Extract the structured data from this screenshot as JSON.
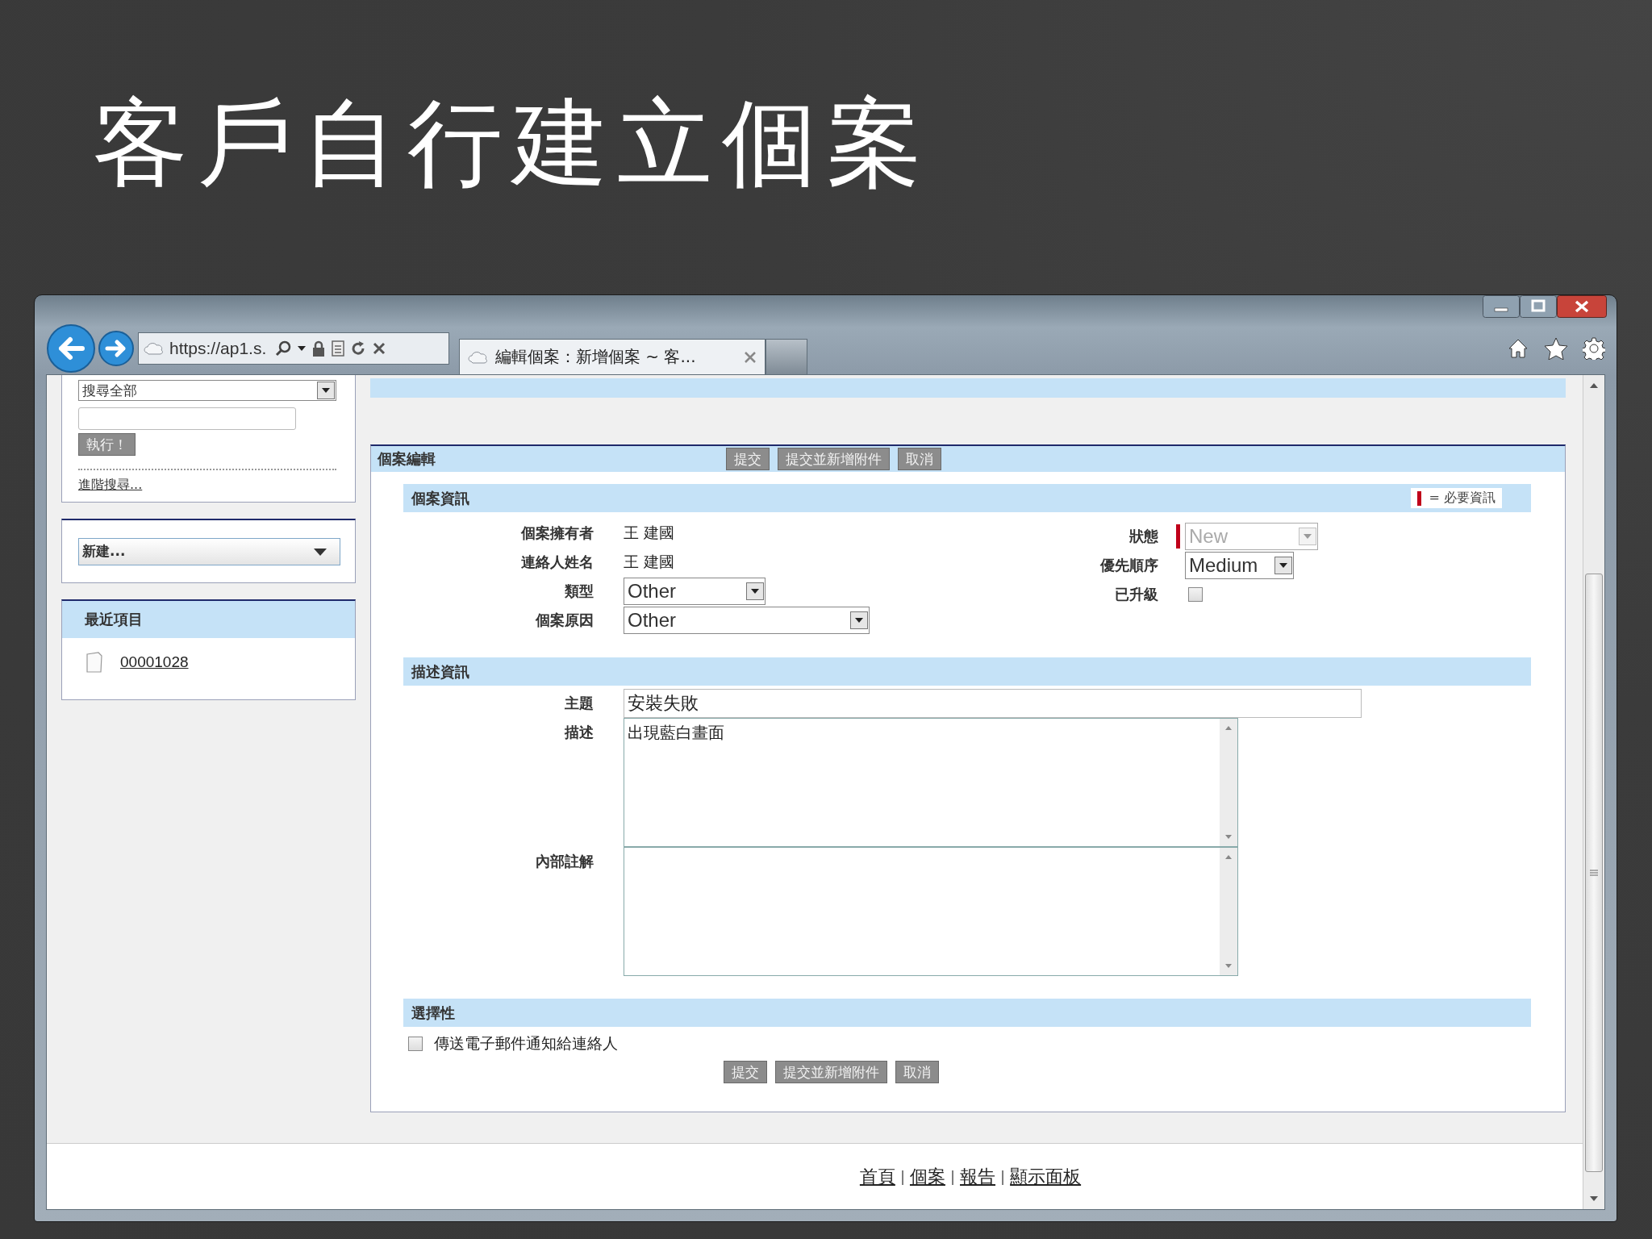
{
  "slide_title": "客戶自行建立個案",
  "browser": {
    "address": "https://ap1.s.",
    "tab_title": "編輯個案：新增個案 ~ 客..."
  },
  "sidebar": {
    "search_scope": "搜尋全部",
    "search_button": "執行！",
    "advanced_search": "進階搜尋...",
    "create_new": "新建...",
    "recent_title": "最近項目",
    "recent_items": [
      {
        "label": "00001028"
      }
    ]
  },
  "case_edit": {
    "title": "個案編輯",
    "top_buttons": [
      "提交",
      "提交並新增附件",
      "取消"
    ],
    "case_info": {
      "title": "個案資訊",
      "required_legend": "= 必要資訊",
      "left_fields": [
        {
          "label": "個案擁有者",
          "kind": "text",
          "value": "王 建國",
          "required": false,
          "disabled": false
        },
        {
          "label": "連絡人姓名",
          "kind": "text",
          "value": "王 建國",
          "required": false,
          "disabled": false
        },
        {
          "label": "類型",
          "kind": "select",
          "value": "Other",
          "required": false,
          "disabled": false
        },
        {
          "label": "個案原因",
          "kind": "select",
          "value": "Other",
          "required": false,
          "disabled": false
        }
      ],
      "right_fields": [
        {
          "label": "狀態",
          "kind": "select",
          "value": "New",
          "required": true,
          "disabled": true
        },
        {
          "label": "優先順序",
          "kind": "select",
          "value": "Medium",
          "required": false,
          "disabled": false
        },
        {
          "label": "已升級",
          "kind": "checkbox",
          "checked": false,
          "required": false,
          "disabled": false
        }
      ]
    },
    "description_info": {
      "title": "描述資訊",
      "fields": [
        {
          "label": "主題",
          "kind": "input",
          "value": "安裝失敗"
        },
        {
          "label": "描述",
          "kind": "textarea",
          "value": "出現藍白畫面"
        },
        {
          "label": "內部註解",
          "kind": "textarea"
        }
      ]
    },
    "optional": {
      "title": "選擇性",
      "options": [
        {
          "label": "傳送電子郵件通知給連絡人",
          "checked": false
        }
      ]
    },
    "bottom_buttons": [
      "提交",
      "提交並新增附件",
      "取消"
    ]
  },
  "footer": [
    {
      "kind": "link",
      "text": "首頁"
    },
    {
      "kind": "separator",
      "text": "|"
    },
    {
      "kind": "link",
      "text": "個案"
    },
    {
      "kind": "separator",
      "text": "|"
    },
    {
      "kind": "link",
      "text": "報告"
    },
    {
      "kind": "separator",
      "text": "|"
    },
    {
      "kind": "link",
      "text": "顯示面板"
    }
  ]
}
